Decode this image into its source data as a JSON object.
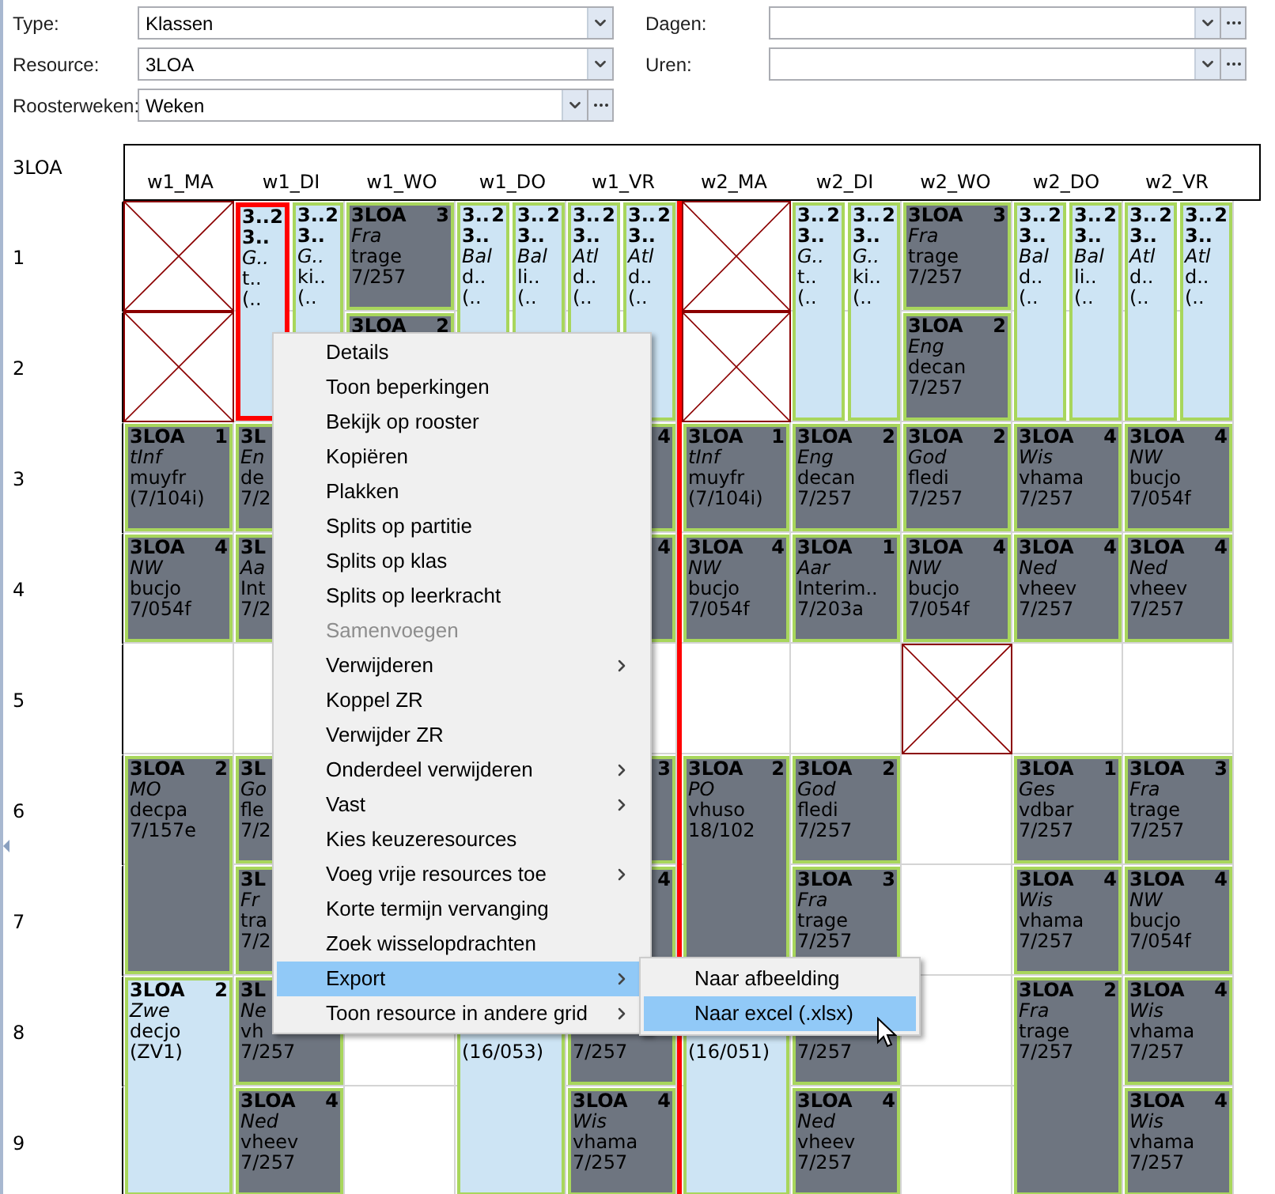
{
  "filters": [
    {
      "label": "Type:",
      "value": "Klassen",
      "more": false
    },
    {
      "label": "Resource:",
      "value": "3LOA",
      "more": false
    },
    {
      "label": "Roosterweken:",
      "value": "Weken",
      "more": true
    }
  ],
  "filters_right": [
    {
      "label": "Dagen:",
      "more": true
    },
    {
      "label": "Uren:",
      "more": true
    }
  ],
  "grid": {
    "title": "3LOA",
    "columns": [
      "w1_MA",
      "w1_DI",
      "w1_WO",
      "w1_DO",
      "w1_VR",
      "w2_MA",
      "w2_DI",
      "w2_WO",
      "w2_DO",
      "w2_VR"
    ],
    "periods": [
      "1",
      "2",
      "3",
      "4",
      "5",
      "6",
      "7",
      "8",
      "9"
    ],
    "days": [
      {
        "cells": [
          {
            "kind": "crossed"
          },
          {
            "kind": "crossed"
          },
          {
            "kind": "lesson",
            "color": "#6e7580",
            "selected": false,
            "group": "3LOA",
            "count": "1",
            "subject": "tInf",
            "teacher": "muyfr",
            "room": "(7/104i)"
          },
          {
            "kind": "lesson",
            "color": "#6e7580",
            "selected": false,
            "group": "3LOA",
            "count": "4",
            "subject": "NW",
            "teacher": "bucjo",
            "room": "7/054f"
          },
          {
            "kind": "empty"
          },
          {
            "kind": "lesson",
            "double": true,
            "color": "#6e7580",
            "selected": false,
            "group": "3LOA",
            "count": "2",
            "subject": "MO",
            "teacher": "decpa",
            "room": "7/157e"
          },
          {
            "kind": "lesson",
            "double": true,
            "color": "#cde4f4",
            "selected": false,
            "group": "3LOA",
            "count": "2",
            "subject": "Zwe",
            "teacher": "decjo",
            "room": "(ZV1)"
          }
        ]
      },
      {
        "cells": [
          {
            "kind": "pair",
            "double": true,
            "parts": [
              {
                "color": "#cde4f4",
                "selected": true,
                "group": "3..",
                "count": "2",
                "subgroup": "3..",
                "subject": "G..",
                "teacher": "t..",
                "room": "(.."
              },
              {
                "color": "#cde4f4",
                "selected": false,
                "group": "3..",
                "count": "2",
                "subgroup": "3..",
                "subject": "G..",
                "teacher": "ki..",
                "room": "(.."
              }
            ]
          },
          {
            "kind": "lesson",
            "color": "#6e7580",
            "selected": false,
            "group": "3L",
            "subject": "En",
            "teacher": "de",
            "room": "7/2"
          },
          {
            "kind": "lesson",
            "color": "#6e7580",
            "selected": false,
            "group": "3L",
            "subject": "Aa",
            "teacher": "Int",
            "room": "7/2"
          },
          {
            "kind": "empty"
          },
          {
            "kind": "lesson",
            "color": "#6e7580",
            "selected": false,
            "group": "3L",
            "subject": "Go",
            "teacher": "fle",
            "room": "7/2"
          },
          {
            "kind": "lesson",
            "color": "#6e7580",
            "selected": false,
            "group": "3L",
            "subject": "Fr",
            "teacher": "tra",
            "room": "7/2"
          },
          {
            "kind": "lesson",
            "color": "#6e7580",
            "selected": false,
            "group": "3L",
            "subject": "Ne",
            "teacher": "vh",
            "room": "7/257"
          },
          {
            "kind": "lesson",
            "color": "#6e7580",
            "selected": false,
            "group": "3LOA",
            "count": "4",
            "subject": "Ned",
            "teacher": "vheev",
            "room": "7/257"
          }
        ]
      },
      {
        "cells": [
          {
            "kind": "lesson",
            "color": "#6e7580",
            "selected": false,
            "group": "3LOA",
            "count": "3",
            "subject": "Fra",
            "teacher": "trage",
            "room": "7/257"
          },
          {
            "kind": "lesson",
            "color": "#6e7580",
            "selected": false,
            "group": "3LOA",
            "count": "2"
          },
          {
            "kind": "empty"
          },
          {
            "kind": "empty"
          },
          {
            "kind": "empty"
          },
          {
            "kind": "empty"
          },
          {
            "kind": "empty"
          },
          {
            "kind": "empty"
          },
          {
            "kind": "empty"
          }
        ]
      },
      {
        "cells": [
          {
            "kind": "pair",
            "double": true,
            "parts": [
              {
                "color": "#cde4f4",
                "selected": false,
                "group": "3..",
                "count": "2",
                "subgroup": "3..",
                "subject": "Bal",
                "teacher": "d..",
                "room": "(.."
              },
              {
                "color": "#cde4f4",
                "selected": false,
                "group": "3..",
                "count": "2",
                "subgroup": "3..",
                "subject": "Bal",
                "teacher": "li..",
                "room": "(.."
              }
            ]
          },
          {
            "kind": "empty"
          },
          {
            "kind": "empty"
          },
          {
            "kind": "empty"
          },
          {
            "kind": "empty"
          },
          {
            "kind": "empty"
          },
          {
            "kind": "lesson",
            "double": true,
            "color": "#cde4f4",
            "selected": false,
            "room": "(16/053)"
          }
        ]
      },
      {
        "cells": [
          {
            "kind": "pair",
            "double": true,
            "parts": [
              {
                "color": "#cde4f4",
                "selected": false,
                "group": "3..",
                "count": "2",
                "subgroup": "3..",
                "subject": "Atl",
                "teacher": "d..",
                "room": "(.."
              },
              {
                "color": "#cde4f4",
                "selected": false,
                "group": "3..",
                "count": "2",
                "subgroup": "3..",
                "subject": "Atl",
                "teacher": "d..",
                "room": "(.."
              }
            ]
          },
          {
            "kind": "lesson",
            "color": "#6e7580",
            "selected": false,
            "count": "4"
          },
          {
            "kind": "lesson",
            "color": "#6e7580",
            "selected": false,
            "count": "4"
          },
          {
            "kind": "empty"
          },
          {
            "kind": "lesson",
            "color": "#6e7580",
            "selected": false,
            "count": "3"
          },
          {
            "kind": "lesson",
            "color": "#6e7580",
            "selected": false,
            "count": "4"
          },
          {
            "kind": "lesson",
            "color": "#6e7580",
            "selected": false,
            "room": "7/257"
          },
          {
            "kind": "lesson",
            "color": "#6e7580",
            "selected": false,
            "group": "3LOA",
            "count": "4",
            "subject": "Wis",
            "teacher": "vhama",
            "room": "7/257"
          }
        ]
      },
      {
        "cells": [
          {
            "kind": "crossed"
          },
          {
            "kind": "crossed"
          },
          {
            "kind": "lesson",
            "color": "#6e7580",
            "selected": false,
            "group": "3LOA",
            "count": "1",
            "subject": "tInf",
            "teacher": "muyfr",
            "room": "(7/104i)"
          },
          {
            "kind": "lesson",
            "color": "#6e7580",
            "selected": false,
            "group": "3LOA",
            "count": "4",
            "subject": "NW",
            "teacher": "bucjo",
            "room": "7/054f"
          },
          {
            "kind": "empty"
          },
          {
            "kind": "lesson",
            "double": true,
            "color": "#6e7580",
            "selected": false,
            "group": "3LOA",
            "count": "2",
            "subject": "PO",
            "teacher": "vhuso",
            "room": "18/102"
          },
          {
            "kind": "lesson",
            "double": true,
            "color": "#cde4f4",
            "selected": false,
            "room": "(16/051)"
          }
        ]
      },
      {
        "cells": [
          {
            "kind": "pair",
            "double": true,
            "parts": [
              {
                "color": "#cde4f4",
                "selected": false,
                "group": "3..",
                "count": "2",
                "subgroup": "3..",
                "subject": "G..",
                "teacher": "t..",
                "room": "(.."
              },
              {
                "color": "#cde4f4",
                "selected": false,
                "group": "3..",
                "count": "2",
                "subgroup": "3..",
                "subject": "G..",
                "teacher": "ki..",
                "room": "(.."
              }
            ]
          },
          {
            "kind": "lesson",
            "color": "#6e7580",
            "selected": false,
            "group": "3LOA",
            "count": "2",
            "subject": "Eng",
            "teacher": "decan",
            "room": "7/257"
          },
          {
            "kind": "lesson",
            "color": "#6e7580",
            "selected": false,
            "group": "3LOA",
            "count": "1",
            "subject": "Aar",
            "teacher": "Interim..",
            "room": "7/203a"
          },
          {
            "kind": "empty"
          },
          {
            "kind": "lesson",
            "color": "#6e7580",
            "selected": false,
            "group": "3LOA",
            "count": "2",
            "subject": "God",
            "teacher": "fledi",
            "room": "7/257"
          },
          {
            "kind": "lesson",
            "color": "#6e7580",
            "selected": false,
            "group": "3LOA",
            "count": "3",
            "subject": "Fra",
            "teacher": "trage",
            "room": "7/257"
          },
          {
            "kind": "lesson",
            "color": "#6e7580",
            "selected": false,
            "room": "7/257"
          },
          {
            "kind": "lesson",
            "color": "#6e7580",
            "selected": false,
            "group": "3LOA",
            "count": "4",
            "subject": "Ned",
            "teacher": "vheev",
            "room": "7/257"
          }
        ]
      },
      {
        "cells": [
          {
            "kind": "lesson",
            "color": "#6e7580",
            "selected": false,
            "group": "3LOA",
            "count": "3",
            "subject": "Fra",
            "teacher": "trage",
            "room": "7/257"
          },
          {
            "kind": "lesson",
            "color": "#6e7580",
            "selected": false,
            "group": "3LOA",
            "count": "2",
            "subject": "Eng",
            "teacher": "decan",
            "room": "7/257"
          },
          {
            "kind": "lesson",
            "color": "#6e7580",
            "selected": false,
            "group": "3LOA",
            "count": "2",
            "subject": "God",
            "teacher": "fledi",
            "room": "7/257"
          },
          {
            "kind": "lesson",
            "color": "#6e7580",
            "selected": false,
            "group": "3LOA",
            "count": "4",
            "subject": "NW",
            "teacher": "bucjo",
            "room": "7/054f"
          },
          {
            "kind": "crossed"
          },
          {
            "kind": "empty"
          },
          {
            "kind": "empty"
          },
          {
            "kind": "empty"
          },
          {
            "kind": "empty"
          }
        ]
      },
      {
        "cells": [
          {
            "kind": "pair",
            "double": true,
            "parts": [
              {
                "color": "#cde4f4",
                "selected": false,
                "group": "3..",
                "count": "2",
                "subgroup": "3..",
                "subject": "Bal",
                "teacher": "d..",
                "room": "(.."
              },
              {
                "color": "#cde4f4",
                "selected": false,
                "group": "3..",
                "count": "2",
                "subgroup": "3..",
                "subject": "Bal",
                "teacher": "li..",
                "room": "(.."
              }
            ]
          },
          {
            "kind": "lesson",
            "color": "#6e7580",
            "selected": false,
            "group": "3LOA",
            "count": "4",
            "subject": "Wis",
            "teacher": "vhama",
            "room": "7/257"
          },
          {
            "kind": "lesson",
            "color": "#6e7580",
            "selected": false,
            "group": "3LOA",
            "count": "4",
            "subject": "Ned",
            "teacher": "vheev",
            "room": "7/257"
          },
          {
            "kind": "empty"
          },
          {
            "kind": "lesson",
            "color": "#6e7580",
            "selected": false,
            "group": "3LOA",
            "count": "1",
            "subject": "Ges",
            "teacher": "vdbar",
            "room": "7/257"
          },
          {
            "kind": "lesson",
            "color": "#6e7580",
            "selected": false,
            "group": "3LOA",
            "count": "4",
            "subject": "Wis",
            "teacher": "vhama",
            "room": "7/257"
          },
          {
            "kind": "lesson",
            "double": true,
            "color": "#6e7580",
            "selected": false,
            "group": "3LOA",
            "count": "2",
            "subject": "Fra",
            "teacher": "trage",
            "room": "7/257"
          }
        ]
      },
      {
        "cells": [
          {
            "kind": "pair",
            "double": true,
            "parts": [
              {
                "color": "#cde4f4",
                "selected": false,
                "group": "3..",
                "count": "2",
                "subgroup": "3..",
                "subject": "Atl",
                "teacher": "d..",
                "room": "(.."
              },
              {
                "color": "#cde4f4",
                "selected": false,
                "group": "3..",
                "count": "2",
                "subgroup": "3..",
                "subject": "Atl",
                "teacher": "d..",
                "room": "(.."
              }
            ]
          },
          {
            "kind": "lesson",
            "color": "#6e7580",
            "selected": false,
            "group": "3LOA",
            "count": "4",
            "subject": "NW",
            "teacher": "bucjo",
            "room": "7/054f"
          },
          {
            "kind": "lesson",
            "color": "#6e7580",
            "selected": false,
            "group": "3LOA",
            "count": "4",
            "subject": "Ned",
            "teacher": "vheev",
            "room": "7/257"
          },
          {
            "kind": "empty"
          },
          {
            "kind": "lesson",
            "color": "#6e7580",
            "selected": false,
            "group": "3LOA",
            "count": "3",
            "subject": "Fra",
            "teacher": "trage",
            "room": "7/257"
          },
          {
            "kind": "lesson",
            "color": "#6e7580",
            "selected": false,
            "group": "3LOA",
            "count": "4",
            "subject": "NW",
            "teacher": "bucjo",
            "room": "7/054f"
          },
          {
            "kind": "lesson",
            "color": "#6e7580",
            "selected": false,
            "group": "3LOA",
            "count": "4",
            "subject": "Wis",
            "teacher": "vhama",
            "room": "7/257"
          },
          {
            "kind": "lesson",
            "color": "#6e7580",
            "selected": false,
            "group": "3LOA",
            "count": "4",
            "subject": "Wis",
            "teacher": "vhama",
            "room": "7/257"
          }
        ]
      }
    ]
  },
  "context_menu": {
    "items": [
      {
        "label": "Details",
        "disabled": false,
        "submenu": false,
        "selected": false
      },
      {
        "label": "Toon beperkingen",
        "disabled": false,
        "submenu": false,
        "selected": false
      },
      {
        "label": "Bekijk op rooster",
        "disabled": false,
        "submenu": false,
        "selected": false
      },
      {
        "label": "Kopiëren",
        "disabled": false,
        "submenu": false,
        "selected": false
      },
      {
        "label": "Plakken",
        "disabled": false,
        "submenu": false,
        "selected": false
      },
      {
        "label": "Splits op partitie",
        "disabled": false,
        "submenu": false,
        "selected": false
      },
      {
        "label": "Splits op klas",
        "disabled": false,
        "submenu": false,
        "selected": false
      },
      {
        "label": "Splits op leerkracht",
        "disabled": false,
        "submenu": false,
        "selected": false
      },
      {
        "label": "Samenvoegen",
        "disabled": true,
        "submenu": false,
        "selected": false
      },
      {
        "label": "Verwijderen",
        "disabled": false,
        "submenu": true,
        "selected": false
      },
      {
        "label": "Koppel ZR",
        "disabled": false,
        "submenu": false,
        "selected": false
      },
      {
        "label": "Verwijder ZR",
        "disabled": false,
        "submenu": false,
        "selected": false
      },
      {
        "label": "Onderdeel verwijderen",
        "disabled": false,
        "submenu": true,
        "selected": false
      },
      {
        "label": "Vast",
        "disabled": false,
        "submenu": true,
        "selected": false
      },
      {
        "label": "Kies keuzeresources",
        "disabled": false,
        "submenu": false,
        "selected": false
      },
      {
        "label": "Voeg vrije resources toe",
        "disabled": false,
        "submenu": true,
        "selected": false
      },
      {
        "label": "Korte termijn vervanging",
        "disabled": false,
        "submenu": false,
        "selected": false
      },
      {
        "label": "Zoek wisselopdrachten",
        "disabled": false,
        "submenu": false,
        "selected": false
      },
      {
        "label": "Export",
        "disabled": false,
        "submenu": true,
        "selected": true
      },
      {
        "label": "Toon resource in andere grid",
        "disabled": false,
        "submenu": true,
        "selected": false
      }
    ]
  },
  "submenu": {
    "items": [
      {
        "label": "Naar afbeelding",
        "selected": false
      },
      {
        "label": "Naar excel (.xlsx)",
        "selected": true
      }
    ]
  }
}
